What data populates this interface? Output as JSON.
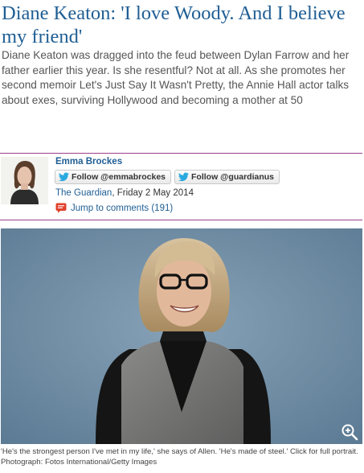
{
  "article": {
    "headline": "Diane Keaton: 'I love Woody. And I believe my friend'",
    "standfirst": "Diane Keaton was dragged into the feud between Dylan Farrow and her father earlier this year. Is she resentful? Not at all. As she promotes her second memoir Let's Just Say It Wasn't Pretty, the Annie Hall actor talks about exes, surviving Hollywood and becoming a mother at 50"
  },
  "byline": {
    "author": "Emma Brockes",
    "follow_author": "Follow @emmabrockes",
    "follow_publication": "Follow @guardianus",
    "publication": "The Guardian",
    "date": ", Friday 2 May 2014",
    "comments_link": "Jump to comments (191)"
  },
  "photo": {
    "caption": "'He's the strongest person I've met in my life,' she says of Allen. 'He's made of steel.' Click for full portrait. Photograph: Fotos International/Getty Images"
  },
  "colors": {
    "headline": "#1f5e94",
    "rule": "#9c3f8c",
    "twitter": "#2aa9e0",
    "comments_icon": "#e0402b",
    "photo_background": "#6f8ca3"
  },
  "icons": {
    "follow": "twitter-bird-icon",
    "comments": "comment-bubble-icon",
    "zoom": "zoom-in-icon"
  }
}
